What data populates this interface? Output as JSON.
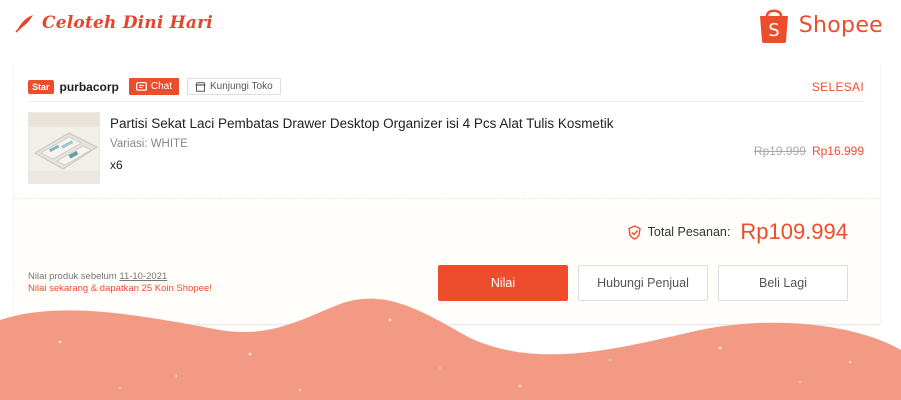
{
  "brand": {
    "blog_name": "Celoteh Dini Hari",
    "shopee_name": "Shopee",
    "shopee_bag_letter": "S"
  },
  "order": {
    "shop": {
      "badge": "Star",
      "name": "purbacorp",
      "chat_label": "Chat",
      "visit_label": "Kunjungi Toko"
    },
    "status": "SELESAI",
    "product": {
      "title": "Partisi Sekat Laci Pembatas Drawer Desktop Organizer isi 4 Pcs Alat Tulis Kosmetik",
      "variant": "Variasi: WHITE",
      "quantity": "x6",
      "original_price": "Rp19.999",
      "price": "Rp16.999"
    },
    "total_label": "Total Pesanan:",
    "total_value": "Rp109.994",
    "rating_note": {
      "prefix": "Nilai produk sebelum ",
      "date": "11-10-2021",
      "promo": "Nilai sekarang & dapatkan 25 Koin Shopee!"
    },
    "actions": {
      "rate": "Nilai",
      "contact": "Hubungi Penjual",
      "buy_again": "Beli Lagi"
    }
  },
  "colors": {
    "accent": "#ee4d2d",
    "wave": "#f29a83"
  }
}
